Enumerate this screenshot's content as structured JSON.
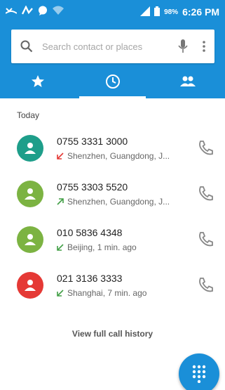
{
  "status_bar": {
    "battery": "98%",
    "time": "6:26 PM",
    "icons": [
      "missed-call-icon",
      "tty-icon",
      "chat-bubble-icon",
      "wifi-icon",
      "signal-icon",
      "battery-icon"
    ]
  },
  "search": {
    "placeholder": "Search contact or places",
    "icons": [
      "search-icon",
      "mic-icon",
      "more-vert-icon"
    ]
  },
  "tabs": [
    {
      "name": "favorites",
      "icon": "star-icon",
      "active": false
    },
    {
      "name": "recents",
      "icon": "clock-icon",
      "active": true
    },
    {
      "name": "contacts",
      "icon": "people-icon",
      "active": false
    }
  ],
  "section_title": "Today",
  "calls": [
    {
      "number": "0755 3331 3000",
      "detail": "Shenzhen, Guangdong, J...",
      "type": "missed",
      "avatar_color": "#1e9e8a"
    },
    {
      "number": "0755 3303 5520",
      "detail": "Shenzhen, Guangdong, J...",
      "type": "outgoing",
      "avatar_color": "#7cb342"
    },
    {
      "number": "010 5836 4348",
      "detail": "Beijing, 1 min. ago",
      "type": "incoming",
      "avatar_color": "#7cb342"
    },
    {
      "number": "021 3136 3333",
      "detail": "Shanghai, 7 min. ago",
      "type": "incoming",
      "avatar_color": "#e53935"
    }
  ],
  "full_history_label": "View full call history",
  "colors": {
    "primary": "#1a8fd8",
    "missed": "#e53935",
    "received": "#43a047"
  }
}
